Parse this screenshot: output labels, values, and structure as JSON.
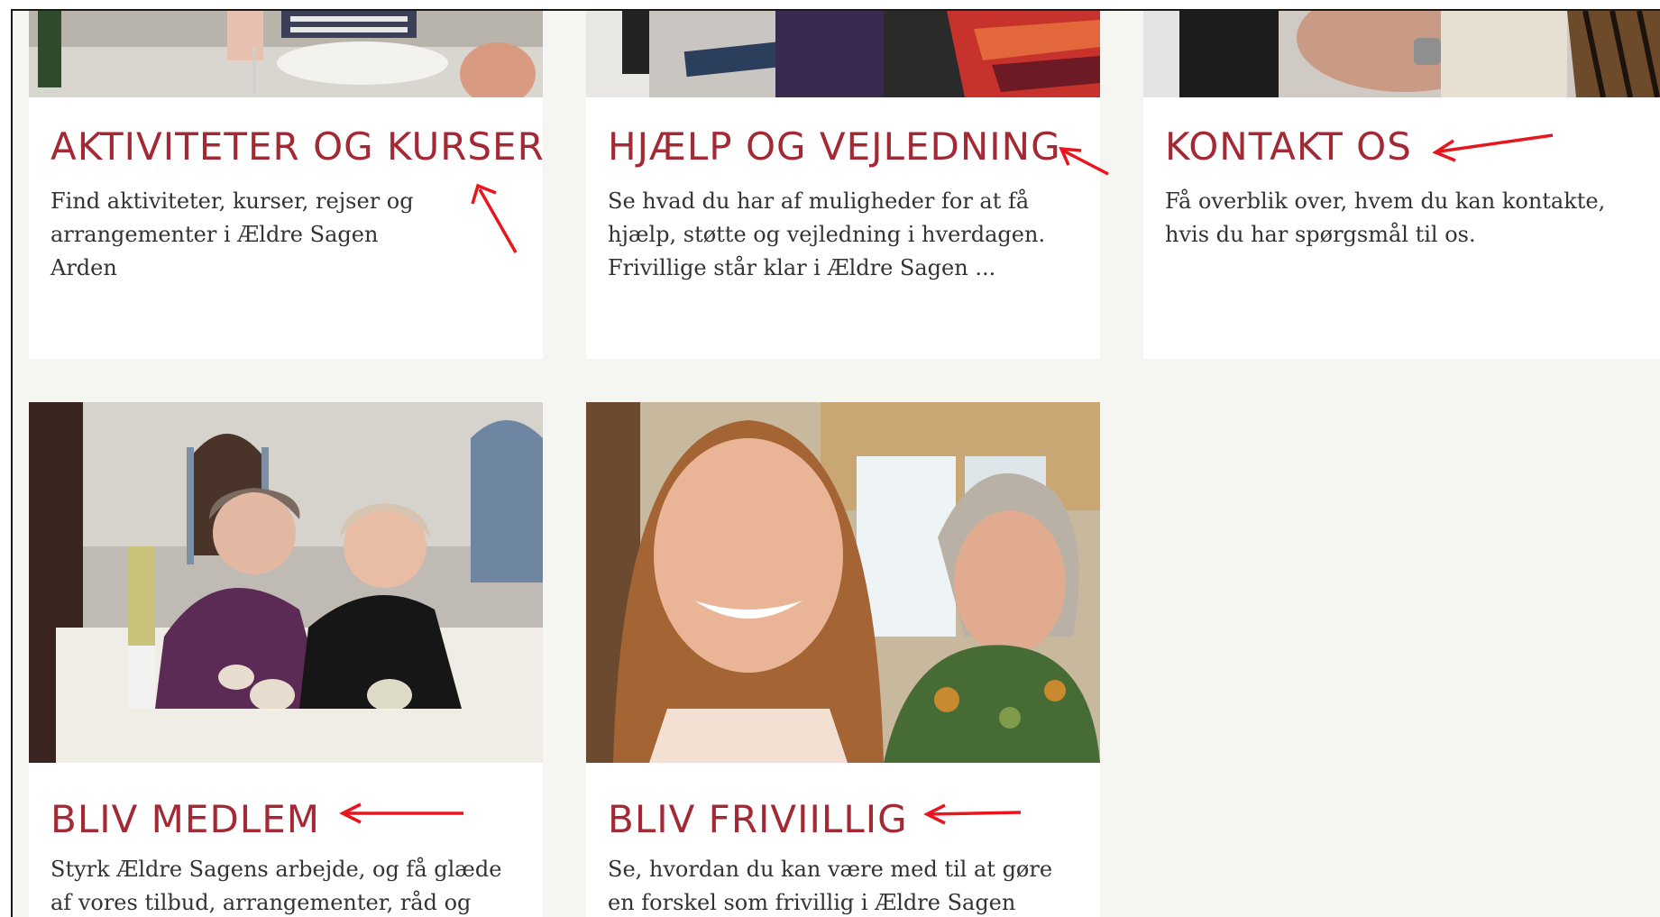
{
  "colors": {
    "heading": "#a32a35",
    "arrow": "#e8151d",
    "background": "#f5f5f2",
    "card": "#ffffff"
  },
  "cards": [
    {
      "title": "AKTIVITETER OG KURSER",
      "description": "Find aktiviteter, kurser, rejser og arrangementer i Ældre Sagen Arden"
    },
    {
      "title": "HJÆLP OG VEJLEDNING",
      "description": "Se hvad du har af muligheder for at få hjælp, støtte og vejledning i hverdagen. Frivillige står klar i Ældre Sagen ..."
    },
    {
      "title": "KONTAKT OS",
      "description": "Få overblik over, hvem du kan kontakte, hvis du har spørgsmål til os."
    },
    {
      "title": "BLIV MEDLEM",
      "description": "Styrk Ældre Sagens arbejde, og få glæde af vores tilbud, arrangementer, råd og støtte."
    },
    {
      "title": "BLIV FRIVIILLIG",
      "description": "Se, hvordan du kan være med til at gøre en forskel som frivillig i Ældre Sagen Arden"
    }
  ]
}
